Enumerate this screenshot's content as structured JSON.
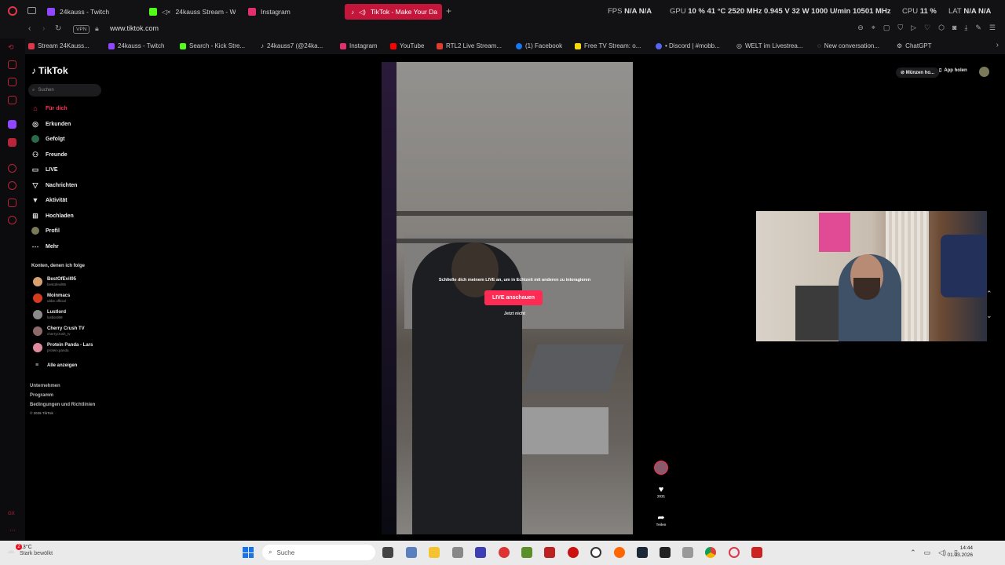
{
  "browser": {
    "tabs": [
      {
        "label": "24kauss - Twitch",
        "color": "#9146ff"
      },
      {
        "label": "24kauss Stream - Wa",
        "color": "#53fc18"
      },
      {
        "label": "Instagram",
        "color": "#e1306c"
      },
      {
        "label": "TikTok - Make Your Da",
        "color": "#ffffff"
      }
    ],
    "hw": {
      "fps_label": "FPS",
      "fps_value": "N/A N/A",
      "gpu_label": "GPU",
      "gpu_value": "10 % 41 °C 2520 MHz 0.945 V 32 W 1000 U/min 10501 MHz",
      "cpu_label": "CPU",
      "cpu_value": "11 %",
      "lat_label": "LAT",
      "lat_value": "N/A N/A"
    },
    "vpn_label": "VPN",
    "url": "www.tiktok.com",
    "bookmarks": [
      {
        "label": "Stream 24Kauss...",
        "color": "#e0364b"
      },
      {
        "label": "24kauss - Twitch",
        "color": "#9146ff"
      },
      {
        "label": "Search - Kick Stre...",
        "color": "#53fc18"
      },
      {
        "label": "24kauss7 (@24ka...",
        "color": "#ffffff"
      },
      {
        "label": "Instagram",
        "color": "#e1306c"
      },
      {
        "label": "YouTube",
        "color": "#ff0000"
      },
      {
        "label": "RTL2 Live Stream...",
        "color": "#e33b2e"
      },
      {
        "label": "(1) Facebook",
        "color": "#1877f2"
      },
      {
        "label": "Free TV Stream: o...",
        "color": "#f5d90a"
      },
      {
        "label": "• Discord | #mobb...",
        "color": "#5865f2"
      },
      {
        "label": "WELT im Livestrea...",
        "color": "#ffffff"
      },
      {
        "label": "New conversation...",
        "color": "#dddddd"
      },
      {
        "label": "ChatGPT",
        "color": "#cccccc"
      }
    ]
  },
  "tiktok": {
    "logo": "TikTok",
    "search_placeholder": "Suchen",
    "nav": [
      {
        "label": "Für dich",
        "icon": "home-icon"
      },
      {
        "label": "Erkunden",
        "icon": "compass-icon"
      },
      {
        "label": "Gefolgt",
        "icon": "following-icon"
      },
      {
        "label": "Freunde",
        "icon": "friends-icon"
      },
      {
        "label": "LIVE",
        "icon": "live-icon"
      },
      {
        "label": "Nachrichten",
        "icon": "messages-icon"
      },
      {
        "label": "Aktivität",
        "icon": "activity-icon"
      },
      {
        "label": "Hochladen",
        "icon": "upload-icon"
      },
      {
        "label": "Profil",
        "icon": "profile-icon"
      },
      {
        "label": "Mehr",
        "icon": "more-icon"
      }
    ],
    "following_title": "Konten, denen ich folge",
    "following": [
      {
        "name": "BestOfEvil95",
        "handle": "bestofevil95",
        "color": "#d8a070"
      },
      {
        "name": "Moinmacs",
        "handle": "ubbe.official",
        "color": "#d63b1f"
      },
      {
        "name": "Lustlord",
        "handle": "lustlord69",
        "color": "#8a8a8a"
      },
      {
        "name": "Cherry Crush TV",
        "handle": "cherrycrush_tv",
        "color": "#8a6a6a"
      },
      {
        "name": "Protein Panda - Lars",
        "handle": "protein.panda",
        "color": "#e08aa0"
      }
    ],
    "show_all": "Alle anzeigen",
    "footer": [
      "Unternehmen",
      "Programm",
      "Bedingungen und Richtlinien",
      "© 2026 TikTok"
    ],
    "coins": "Münzen ho...",
    "get_app": "App holen",
    "live_prompt": "Schließe dich meinem LIVE an, um in Echtzeit mit anderen zu interagieren",
    "live_button": "LIVE anschauen",
    "not_now": "Jetzt nicht",
    "likes": "2031",
    "share": "Teilen"
  },
  "taskbar": {
    "temp": "13°C",
    "weather": "Stark bewölkt",
    "search_placeholder": "Suche",
    "notif_count": "2",
    "time": "14:44",
    "date": "01.03.2026"
  }
}
